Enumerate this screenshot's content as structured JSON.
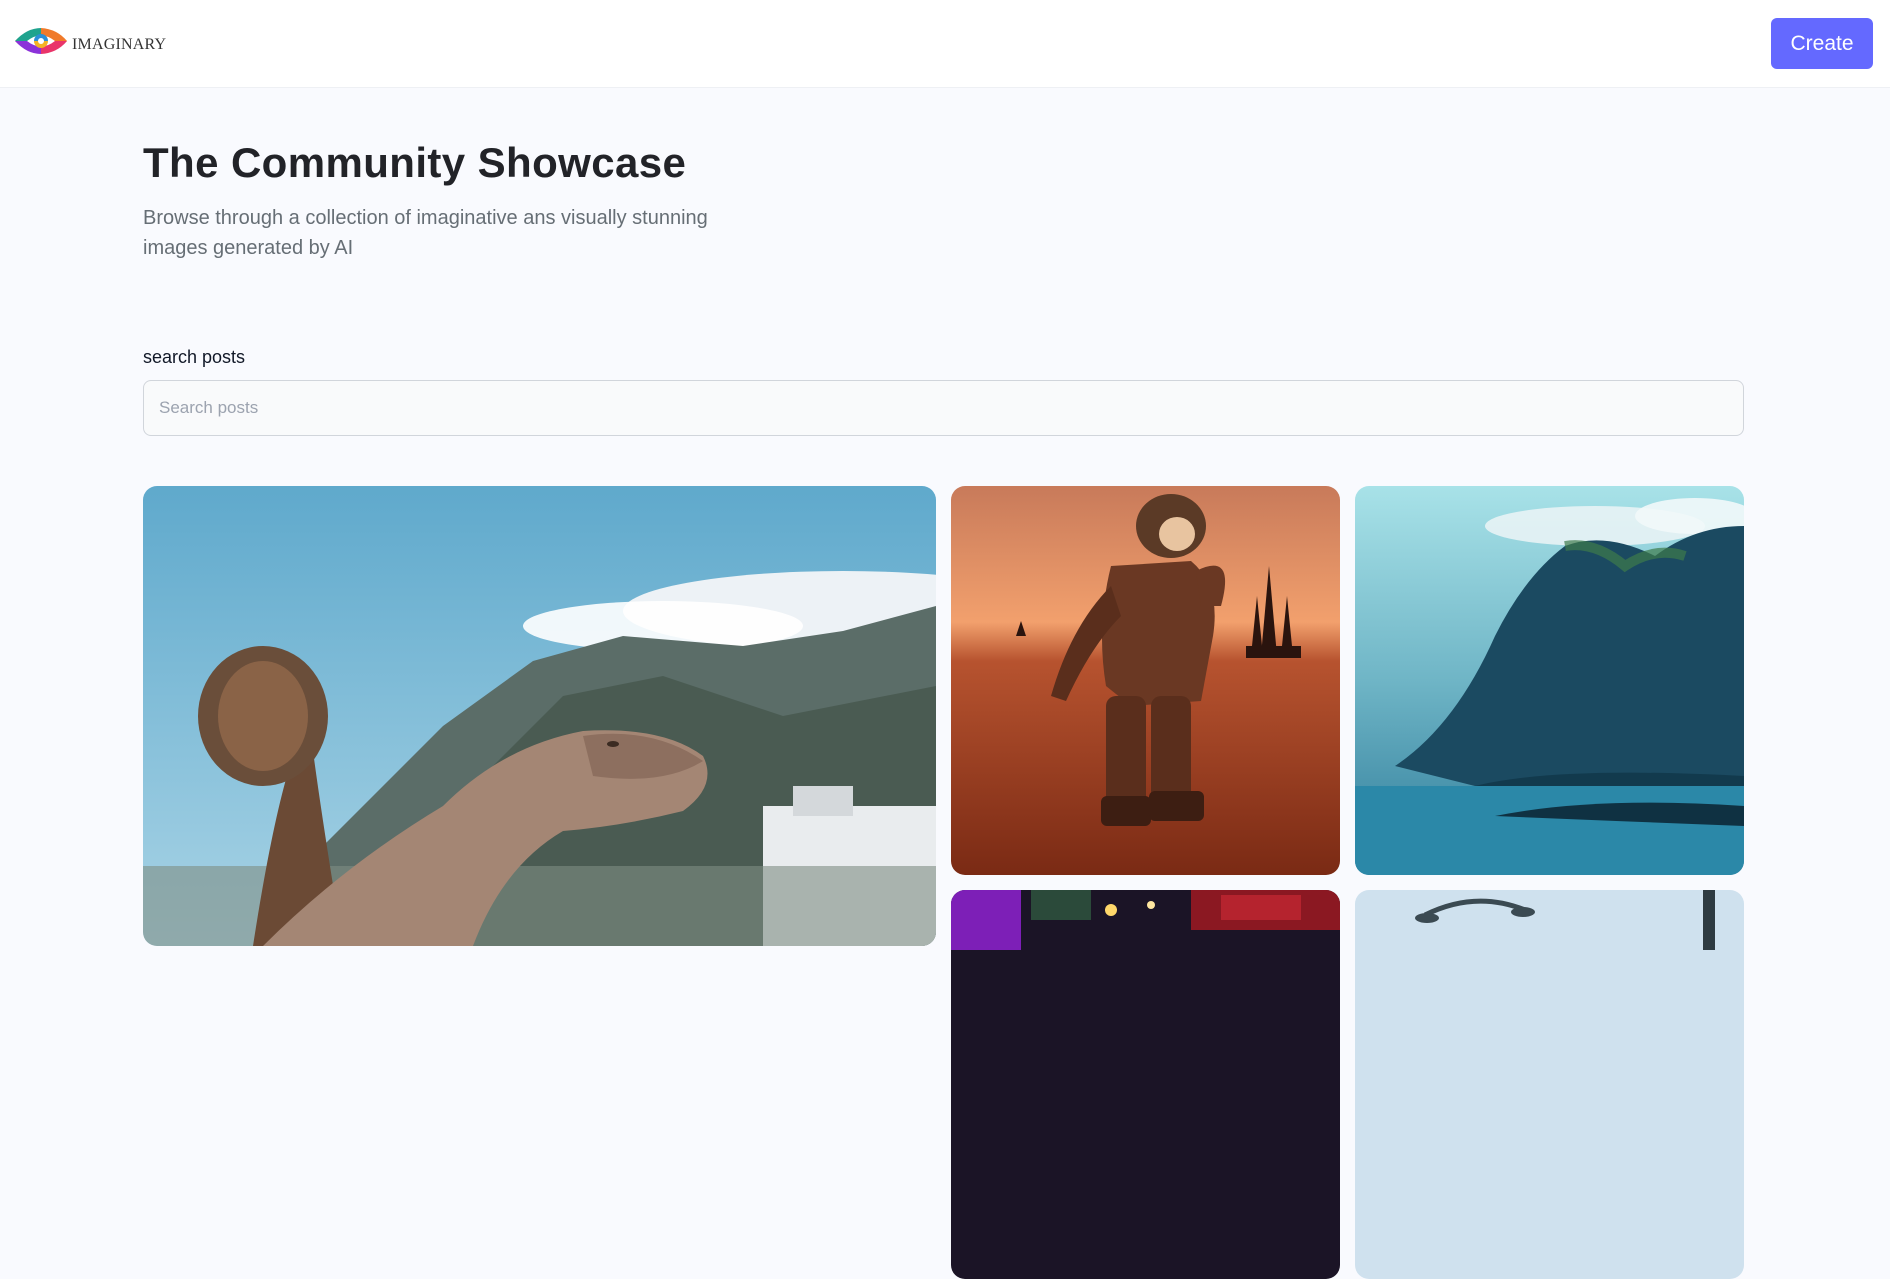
{
  "header": {
    "logo_text": "IMAGINARY",
    "create_label": "Create",
    "logo_icon": "eye-logo-icon"
  },
  "main": {
    "title": "The Community Showcase",
    "subtitle": "Browse through a collection of imaginative ans visually stunning images generated by AI"
  },
  "search": {
    "label": "search posts",
    "placeholder": "Search posts",
    "value": ""
  },
  "colors": {
    "accent": "#6469ff",
    "background": "#f9fafe"
  },
  "gallery": {
    "images": [
      {
        "subject": "dinosaur-statue-mountain"
      },
      {
        "subject": "astronaut-on-mars"
      },
      {
        "subject": "coastal-cliffs-sea"
      },
      {
        "subject": "neon-street-night"
      },
      {
        "subject": "street-lamps-sky"
      }
    ]
  }
}
